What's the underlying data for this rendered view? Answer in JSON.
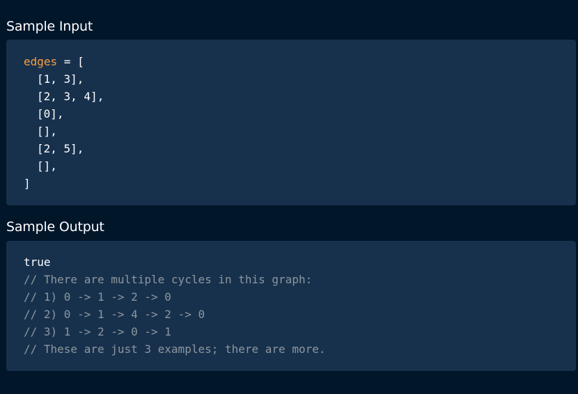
{
  "sample_input": {
    "title": "Sample Input",
    "variable": "edges",
    "operator": " = [",
    "lines": [
      "[1, 3],",
      "[2, 3, 4],",
      "[0],",
      "[],",
      "[2, 5],",
      "[],"
    ],
    "closing": "]"
  },
  "sample_output": {
    "title": "Sample Output",
    "result": "true",
    "comments": [
      "// There are multiple cycles in this graph:",
      "// 1) 0 -> 1 -> 2 -> 0",
      "// 2) 0 -> 1 -> 4 -> 2 -> 0",
      "// 3) 1 -> 2 -> 0 -> 1",
      "// These are just 3 examples; there are more."
    ]
  },
  "colors": {
    "background": "#02162a",
    "code_background": "#17314d",
    "variable": "#f99e3f",
    "comment": "#8e969e",
    "text": "#ffffff"
  }
}
